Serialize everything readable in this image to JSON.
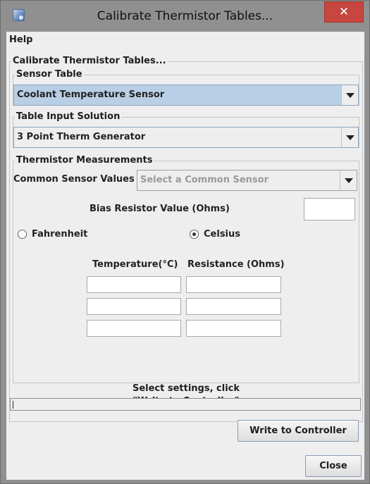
{
  "window": {
    "title": "Calibrate Thermistor Tables...",
    "close_glyph": "✕"
  },
  "menu": {
    "help": "Help"
  },
  "main": {
    "group_title": "Calibrate Thermistor Tables...",
    "sensor_table": {
      "legend": "Sensor Table",
      "selected": "Coolant Temperature Sensor"
    },
    "table_input": {
      "legend": "Table Input Solution",
      "selected": "3 Point Therm Generator"
    },
    "measurements": {
      "legend": "Thermistor Measurements",
      "common_label": "Common Sensor Values",
      "common_placeholder": "Select a Common Sensor",
      "bias_label": "Bias Resistor Value (Ohms)",
      "bias_value": "",
      "units": [
        {
          "label": "Fahrenheit",
          "checked": false
        },
        {
          "label": "Celsius",
          "checked": true
        }
      ],
      "col_temp": "Temperature(°C)",
      "col_res": "Resistance (Ohms)",
      "rows": [
        {
          "temp": "",
          "res": ""
        },
        {
          "temp": "",
          "res": ""
        },
        {
          "temp": "",
          "res": ""
        }
      ]
    },
    "status_line1": "Select settings, click",
    "status_line2": "\"Write to Controller\"",
    "progress_text": ""
  },
  "buttons": {
    "write": "Write to Controller",
    "close": "Close"
  },
  "colors": {
    "selected_combo": "#b8cfe5",
    "close_button": "#c7463f"
  }
}
